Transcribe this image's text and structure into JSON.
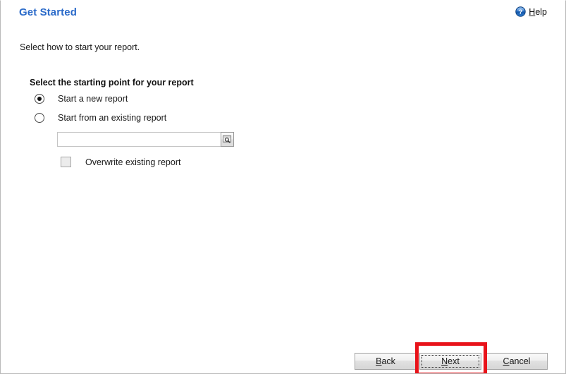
{
  "window": {
    "title": "Get Started"
  },
  "header": {
    "title": "Get Started",
    "help": {
      "icon": "help-circle-icon",
      "accel": "H",
      "rest": "elp",
      "full_label": "Help"
    }
  },
  "body": {
    "intro": "Select how to start your report.",
    "group_label": "Select the starting point for your report",
    "radios": [
      {
        "id": "start-new",
        "label": "Start a new report",
        "checked": true
      },
      {
        "id": "start-existing",
        "label": "Start from an existing report",
        "checked": false
      }
    ],
    "existing_report_field": {
      "value": "",
      "placeholder": "",
      "browse_icon": "magnifier-browse-icon"
    },
    "overwrite_checkbox": {
      "label": "Overwrite existing report",
      "checked": false,
      "enabled": false
    }
  },
  "footer": {
    "buttons": [
      {
        "id": "back",
        "accel": "B",
        "rest": "ack",
        "full_label": "Back",
        "focused": false
      },
      {
        "id": "next",
        "accel": "N",
        "rest": "ext",
        "full_label": "Next",
        "focused": true
      },
      {
        "id": "cancel",
        "accel": "C",
        "rest": "ancel",
        "full_label": "Cancel",
        "focused": false
      }
    ]
  },
  "annotation": {
    "highlight_target": "next-button",
    "color": "#e8131a"
  },
  "colors": {
    "title_blue": "#2a6ac9",
    "text": "#1a1a1a",
    "window_bg": "#ffffff",
    "border": "#b9b9b9",
    "highlight_red": "#e8131a"
  }
}
